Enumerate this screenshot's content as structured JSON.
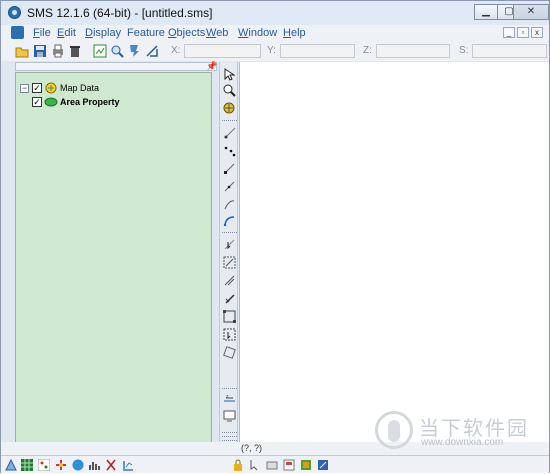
{
  "window": {
    "title": "SMS 12.1.6 (64-bit) - [untitled.sms]"
  },
  "window_controls": {
    "minimize": "▁",
    "maximize": "▢",
    "close": "✕"
  },
  "mdi_controls": {
    "minimize": "_",
    "restore": "▫",
    "close": "x"
  },
  "menu": [
    {
      "label": "File",
      "key": "F"
    },
    {
      "label": "Edit",
      "key": "E"
    },
    {
      "label": "Display",
      "key": "D"
    },
    {
      "label": "Feature Objects",
      "key": "O"
    },
    {
      "label": "Web",
      "key": "W"
    },
    {
      "label": "Window",
      "key": "W"
    },
    {
      "label": "Help",
      "key": "H"
    }
  ],
  "coords": {
    "x_label": "X:",
    "y_label": "Y:",
    "z_label": "Z:",
    "s_label": "S:"
  },
  "tree": {
    "root": {
      "label": "Map Data",
      "checked": true,
      "expanded": true
    },
    "child": {
      "label": "Area Property",
      "checked": true
    }
  },
  "status": {
    "coords": "(?, ?)"
  },
  "watermark": {
    "text": "当下软件园",
    "url": "www.downxia.com"
  },
  "icons": {
    "toolbar": [
      "open-icon",
      "save-icon",
      "print-icon",
      "delete-icon",
      "frame-icon",
      "zoom-icon",
      "get-data-icon",
      "measure-icon"
    ],
    "palette_top": [
      "select-tool-icon",
      "zoom-tool-icon",
      "pan-tool-icon"
    ],
    "palette_mid": [
      "create-node-icon",
      "select-points-icon",
      "select-nodes-icon",
      "select-vertices-icon",
      "create-arc-icon",
      "curved-arc-icon",
      "select-arc-icon",
      "select-arc-group-icon",
      "create-polygon-icon",
      "select-polygon-icon",
      "select-region-icon",
      "split-icon",
      "rotate-icon"
    ],
    "palette_bottom": [
      "contour-icon",
      "display-options-icon"
    ],
    "bottom_left": [
      "mesh-module-icon",
      "grid-module-icon",
      "scatter-module-icon",
      "map-module-icon",
      "gis-module-icon",
      "particle-module-icon",
      "cross-section-icon",
      "quadtree-icon"
    ],
    "bottom_right": [
      "lock-icon",
      "select-all-icon",
      "transform-icon",
      "export-icon",
      "render-icon",
      "cleanup-icon"
    ]
  }
}
